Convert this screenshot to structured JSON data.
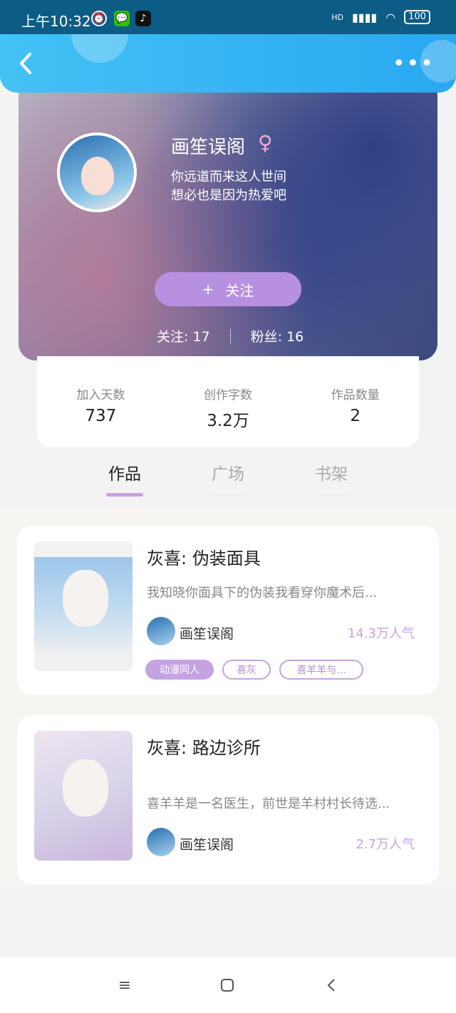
{
  "status_bar": {
    "time": "上午10:32",
    "network": "HD",
    "battery": "100"
  },
  "header": {
    "back_icon": "chevron-left-icon",
    "more_icon": "more-dots-icon"
  },
  "profile": {
    "name": "画笙误阁",
    "gender_symbol": "♀",
    "bio_line1": "你远道而来这人世间",
    "bio_line2": "想必也是因为热爱吧",
    "follow_label": "关注",
    "follow_plus": "+",
    "following": "关注: 17",
    "followers": "粉丝: 16"
  },
  "stats": [
    {
      "label": "加入天数",
      "value": "737"
    },
    {
      "label": "创作字数",
      "value": "3.2万"
    },
    {
      "label": "作品数量",
      "value": "2"
    }
  ],
  "tabs": [
    {
      "label": "作品",
      "active": true
    },
    {
      "label": "广场",
      "active": false
    },
    {
      "label": "书架",
      "active": false
    }
  ],
  "works": [
    {
      "title": "灰喜: 伪装面具",
      "desc": "我知晓你面具下的伪装我看穿你魔术后...",
      "author": "画笙误阁",
      "popularity": "14.3万人气",
      "tags": [
        "动漫同人",
        "喜灰",
        "喜羊羊与..."
      ]
    },
    {
      "title": "灰喜: 路边诊所",
      "desc": "喜羊羊是一名医生，前世是羊村村长待选...",
      "author": "画笙误阁",
      "popularity": "2.7万人气"
    }
  ],
  "colors": {
    "accent": "#c5a3e3",
    "header": "#36b5f3",
    "follow_button": "#b890e0"
  }
}
